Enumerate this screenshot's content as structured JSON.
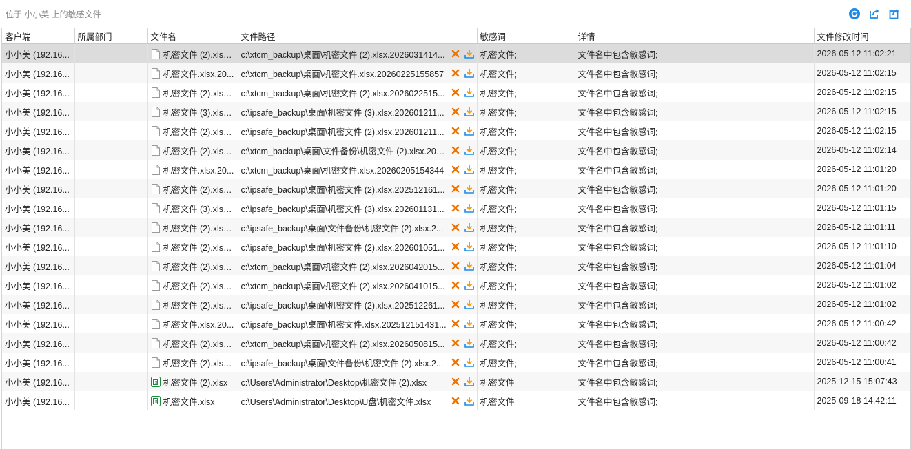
{
  "header": {
    "breadcrumb": "位于 小小美 上的敏感文件"
  },
  "toolbar": {
    "icons": [
      "refresh-icon",
      "export-icon",
      "export-all-icon"
    ],
    "colors": {
      "refresh": "#1e88e5",
      "export": "#1e88e5"
    }
  },
  "columns": [
    "客户端",
    "所属部门",
    "文件名",
    "文件路径",
    "敏感词",
    "详情",
    "文件修改时间"
  ],
  "colors": {
    "delete": "#f07300",
    "download": "#f39c12",
    "excel": "#1d8a3d",
    "selected_row": "#dcdcdc"
  },
  "rows": [
    {
      "client": "小小美 (192.16...",
      "dept": "",
      "filename": "机密文件 (2).xlsx...",
      "filetype": "generic",
      "path": "c:\\xtcm_backup\\桌面\\机密文件 (2).xlsx.2026031414...",
      "keyword": "机密文件;",
      "detail": "文件名中包含敏感词;",
      "time": "2026-05-12 11:02:21"
    },
    {
      "client": "小小美 (192.16...",
      "dept": "",
      "filename": "机密文件.xlsx.20...",
      "filetype": "generic",
      "path": "c:\\xtcm_backup\\桌面\\机密文件.xlsx.20260225155857",
      "keyword": "机密文件;",
      "detail": "文件名中包含敏感词;",
      "time": "2026-05-12 11:02:15"
    },
    {
      "client": "小小美 (192.16...",
      "dept": "",
      "filename": "机密文件 (2).xlsx...",
      "filetype": "generic",
      "path": "c:\\xtcm_backup\\桌面\\机密文件 (2).xlsx.2026022515...",
      "keyword": "机密文件;",
      "detail": "文件名中包含敏感词;",
      "time": "2026-05-12 11:02:15"
    },
    {
      "client": "小小美 (192.16...",
      "dept": "",
      "filename": "机密文件 (3).xlsx...",
      "filetype": "generic",
      "path": "c:\\ipsafe_backup\\桌面\\机密文件 (3).xlsx.202601211...",
      "keyword": "机密文件;",
      "detail": "文件名中包含敏感词;",
      "time": "2026-05-12 11:02:15"
    },
    {
      "client": "小小美 (192.16...",
      "dept": "",
      "filename": "机密文件 (2).xlsx...",
      "filetype": "generic",
      "path": "c:\\ipsafe_backup\\桌面\\机密文件 (2).xlsx.202601211...",
      "keyword": "机密文件;",
      "detail": "文件名中包含敏感词;",
      "time": "2026-05-12 11:02:15"
    },
    {
      "client": "小小美 (192.16...",
      "dept": "",
      "filename": "机密文件 (2).xlsx...",
      "filetype": "generic",
      "path": "c:\\xtcm_backup\\桌面\\文件备份\\机密文件 (2).xlsx.202...",
      "keyword": "机密文件;",
      "detail": "文件名中包含敏感词;",
      "time": "2026-05-12 11:02:14"
    },
    {
      "client": "小小美 (192.16...",
      "dept": "",
      "filename": "机密文件.xlsx.20...",
      "filetype": "generic",
      "path": "c:\\xtcm_backup\\桌面\\机密文件.xlsx.20260205154344",
      "keyword": "机密文件;",
      "detail": "文件名中包含敏感词;",
      "time": "2026-05-12 11:01:20"
    },
    {
      "client": "小小美 (192.16...",
      "dept": "",
      "filename": "机密文件 (2).xlsx...",
      "filetype": "generic",
      "path": "c:\\ipsafe_backup\\桌面\\机密文件 (2).xlsx.202512161...",
      "keyword": "机密文件;",
      "detail": "文件名中包含敏感词;",
      "time": "2026-05-12 11:01:20"
    },
    {
      "client": "小小美 (192.16...",
      "dept": "",
      "filename": "机密文件 (3).xlsx...",
      "filetype": "generic",
      "path": "c:\\ipsafe_backup\\桌面\\机密文件 (3).xlsx.202601131...",
      "keyword": "机密文件;",
      "detail": "文件名中包含敏感词;",
      "time": "2026-05-12 11:01:15"
    },
    {
      "client": "小小美 (192.16...",
      "dept": "",
      "filename": "机密文件 (2).xlsx...",
      "filetype": "generic",
      "path": "c:\\ipsafe_backup\\桌面\\文件备份\\机密文件 (2).xlsx.2...",
      "keyword": "机密文件;",
      "detail": "文件名中包含敏感词;",
      "time": "2026-05-12 11:01:11"
    },
    {
      "client": "小小美 (192.16...",
      "dept": "",
      "filename": "机密文件 (2).xlsx...",
      "filetype": "generic",
      "path": "c:\\ipsafe_backup\\桌面\\机密文件 (2).xlsx.202601051...",
      "keyword": "机密文件;",
      "detail": "文件名中包含敏感词;",
      "time": "2026-05-12 11:01:10"
    },
    {
      "client": "小小美 (192.16...",
      "dept": "",
      "filename": "机密文件 (2).xlsx...",
      "filetype": "generic",
      "path": "c:\\xtcm_backup\\桌面\\机密文件 (2).xlsx.2026042015...",
      "keyword": "机密文件;",
      "detail": "文件名中包含敏感词;",
      "time": "2026-05-12 11:01:04"
    },
    {
      "client": "小小美 (192.16...",
      "dept": "",
      "filename": "机密文件 (2).xlsx...",
      "filetype": "generic",
      "path": "c:\\xtcm_backup\\桌面\\机密文件 (2).xlsx.2026041015...",
      "keyword": "机密文件;",
      "detail": "文件名中包含敏感词;",
      "time": "2026-05-12 11:01:02"
    },
    {
      "client": "小小美 (192.16...",
      "dept": "",
      "filename": "机密文件 (2).xlsx...",
      "filetype": "generic",
      "path": "c:\\ipsafe_backup\\桌面\\机密文件 (2).xlsx.202512261...",
      "keyword": "机密文件;",
      "detail": "文件名中包含敏感词;",
      "time": "2026-05-12 11:01:02"
    },
    {
      "client": "小小美 (192.16...",
      "dept": "",
      "filename": "机密文件.xlsx.20...",
      "filetype": "generic",
      "path": "c:\\ipsafe_backup\\桌面\\机密文件.xlsx.202512151431...",
      "keyword": "机密文件;",
      "detail": "文件名中包含敏感词;",
      "time": "2026-05-12 11:00:42"
    },
    {
      "client": "小小美 (192.16...",
      "dept": "",
      "filename": "机密文件 (2).xlsx...",
      "filetype": "generic",
      "path": "c:\\xtcm_backup\\桌面\\机密文件 (2).xlsx.2026050815...",
      "keyword": "机密文件;",
      "detail": "文件名中包含敏感词;",
      "time": "2026-05-12 11:00:42"
    },
    {
      "client": "小小美 (192.16...",
      "dept": "",
      "filename": "机密文件 (2).xlsx...",
      "filetype": "generic",
      "path": "c:\\ipsafe_backup\\桌面\\文件备份\\机密文件 (2).xlsx.2...",
      "keyword": "机密文件;",
      "detail": "文件名中包含敏感词;",
      "time": "2026-05-12 11:00:41"
    },
    {
      "client": "小小美 (192.16...",
      "dept": "",
      "filename": "机密文件 (2).xlsx",
      "filetype": "excel",
      "path": "c:\\Users\\Administrator\\Desktop\\机密文件 (2).xlsx",
      "keyword": "机密文件",
      "detail": "文件名中包含敏感词;",
      "time": "2025-12-15 15:07:43"
    },
    {
      "client": "小小美 (192.16...",
      "dept": "",
      "filename": "机密文件.xlsx",
      "filetype": "excel",
      "path": "c:\\Users\\Administrator\\Desktop\\U盘\\机密文件.xlsx",
      "keyword": "机密文件",
      "detail": "文件名中包含敏感词;",
      "time": "2025-09-18 14:42:11"
    }
  ]
}
